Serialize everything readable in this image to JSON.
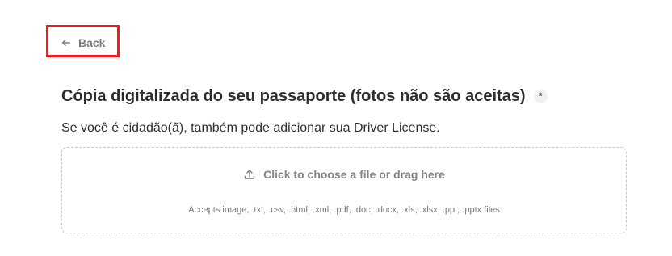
{
  "navigation": {
    "back_label": "Back",
    "back_icon": "arrow-left-icon"
  },
  "form_field": {
    "title": "Cópia digitalizada do seu passaporte (fotos não são aceitas)",
    "required_marker": "*",
    "description": "Se você é cidadão(ã), também pode adicionar sua Driver License."
  },
  "upload": {
    "prompt": "Click to choose a file or drag here",
    "accepted_types": "Accepts image, .txt, .csv, .html, .xml, .pdf, .doc, .docx, .xls, .xlsx, .ppt, .pptx files",
    "icon": "upload-icon"
  },
  "colors": {
    "highlight": "#ff1515",
    "dropzone_border": "#c9c9c9",
    "muted_text": "#858585"
  }
}
